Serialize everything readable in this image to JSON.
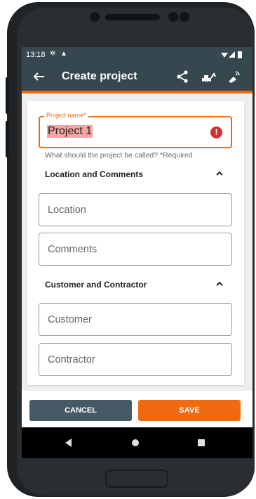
{
  "status_bar": {
    "time": "13:18"
  },
  "app_bar": {
    "title": "Create project"
  },
  "project_name": {
    "label": "Project name*",
    "value": "Project 1",
    "error_mark": "!",
    "helper": "What should the project be called? *Required"
  },
  "sections": [
    {
      "title": "Location and Comments",
      "fields": [
        "Location",
        "Comments"
      ]
    },
    {
      "title": "Customer and Contractor",
      "fields": [
        "Customer",
        "Contractor"
      ]
    }
  ],
  "actions": {
    "cancel": "CANCEL",
    "save": "SAVE"
  },
  "colors": {
    "accent": "#f06a10",
    "appbar": "#37474f",
    "cancel": "#455a64",
    "error": "#d32f2f"
  },
  "icons": [
    "back-arrow-icon",
    "share-icon",
    "excavator-icon",
    "gps-signal-icon",
    "chevron-up-icon",
    "error-icon",
    "nav-back-icon",
    "nav-home-icon",
    "nav-recents-icon"
  ]
}
